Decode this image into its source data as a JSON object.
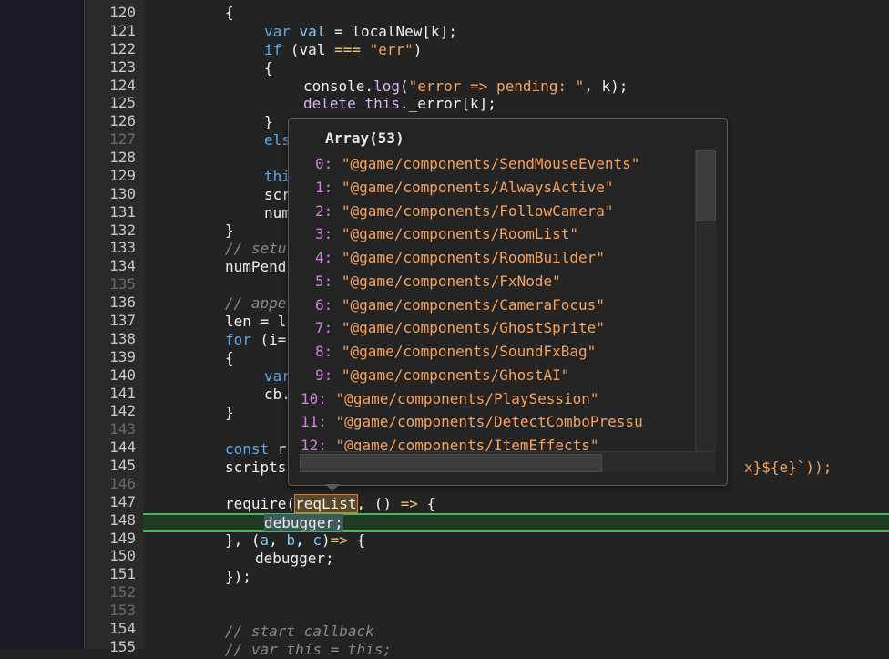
{
  "line_numbers": [
    {
      "n": "120",
      "dim": false
    },
    {
      "n": "121",
      "dim": false
    },
    {
      "n": "122",
      "dim": false
    },
    {
      "n": "123",
      "dim": false
    },
    {
      "n": "124",
      "dim": false
    },
    {
      "n": "125",
      "dim": false
    },
    {
      "n": "126",
      "dim": false
    },
    {
      "n": "127",
      "dim": true
    },
    {
      "n": "128",
      "dim": false
    },
    {
      "n": "129",
      "dim": false
    },
    {
      "n": "130",
      "dim": false
    },
    {
      "n": "131",
      "dim": false
    },
    {
      "n": "132",
      "dim": false
    },
    {
      "n": "133",
      "dim": false
    },
    {
      "n": "134",
      "dim": false
    },
    {
      "n": "135",
      "dim": true
    },
    {
      "n": "136",
      "dim": false
    },
    {
      "n": "137",
      "dim": false
    },
    {
      "n": "138",
      "dim": false
    },
    {
      "n": "139",
      "dim": false
    },
    {
      "n": "140",
      "dim": false
    },
    {
      "n": "141",
      "dim": false
    },
    {
      "n": "142",
      "dim": false
    },
    {
      "n": "143",
      "dim": true
    },
    {
      "n": "144",
      "dim": false
    },
    {
      "n": "145",
      "dim": false
    },
    {
      "n": "146",
      "dim": true
    },
    {
      "n": "147",
      "dim": false
    },
    {
      "n": "148",
      "dim": false
    },
    {
      "n": "149",
      "dim": false
    },
    {
      "n": "150",
      "dim": false
    },
    {
      "n": "151",
      "dim": false
    },
    {
      "n": "152",
      "dim": true
    },
    {
      "n": "153",
      "dim": true
    },
    {
      "n": "154",
      "dim": false
    },
    {
      "n": "155",
      "dim": false
    }
  ],
  "code": {
    "l120": "{",
    "l121_kw": "var",
    "l121_name": "val",
    "l121_op": " = ",
    "l121_rest": "localNew[k];",
    "l122_kw": "if",
    "l122_a": " (val ",
    "l122_op": "===",
    "l122_str": "\"err\"",
    "l122_b": ")",
    "l123": "{",
    "l124_a": "console.",
    "l124_fn": "log",
    "l124_b": "(",
    "l124_str": "\"error => pending: \"",
    "l124_c": ", k);",
    "l125_kw": "delete",
    "l125_this": "this",
    "l125_rest": "._error[k];",
    "l126": "}",
    "l127": "els",
    "l129": "thi",
    "l130": "scr",
    "l131": "num",
    "l132": "}",
    "l133": "// setu",
    "l134": "numPend",
    "l136": "// appe",
    "l137": "len = l",
    "l138_kw": "for",
    "l138_rest": " (i=",
    "l139": "{",
    "l140_kw": "var",
    "l141": "cb.",
    "l142": "}",
    "l144_kw": "const",
    "l144_rest": " r",
    "l145_a": "scripts",
    "l145_b": "x}${e}`));",
    "l147_a": "require(",
    "l147_hl": "reqList",
    "l147_b": ", () ",
    "l147_op": "=>",
    "l147_c": " {",
    "l148": "debugger;",
    "l149_a": "}, (",
    "l149_p1": "a",
    "l149_s1": ", ",
    "l149_p2": "b",
    "l149_s2": ", ",
    "l149_p3": "c",
    "l149_b": ")",
    "l149_op": "=>",
    "l149_c": " {",
    "l150": "debugger;",
    "l151": "});",
    "l154": "// start callback",
    "l155": "// var this = this;"
  },
  "popover": {
    "title": "Array(53)",
    "items": [
      {
        "idx": "0:",
        "val": "\"@game/components/SendMouseEvents\""
      },
      {
        "idx": "1:",
        "val": "\"@game/components/AlwaysActive\""
      },
      {
        "idx": "2:",
        "val": "\"@game/components/FollowCamera\""
      },
      {
        "idx": "3:",
        "val": "\"@game/components/RoomList\""
      },
      {
        "idx": "4:",
        "val": "\"@game/components/RoomBuilder\""
      },
      {
        "idx": "5:",
        "val": "\"@game/components/FxNode\""
      },
      {
        "idx": "6:",
        "val": "\"@game/components/CameraFocus\""
      },
      {
        "idx": "7:",
        "val": "\"@game/components/GhostSprite\""
      },
      {
        "idx": "8:",
        "val": "\"@game/components/SoundFxBag\""
      },
      {
        "idx": "9:",
        "val": "\"@game/components/GhostAI\""
      },
      {
        "idx": "10:",
        "val": "\"@game/components/PlaySession\""
      },
      {
        "idx": "11:",
        "val": "\"@game/components/DetectComboPressu"
      },
      {
        "idx": "12:",
        "val": "\"@game/components/ItemEffects\""
      }
    ]
  },
  "colors": {
    "editor_bg": "#232323",
    "keyword": "#5aa9e6",
    "string": "#f5a25d",
    "array_index": "#d47fe0",
    "paused_line_border": "#3dbb5a"
  }
}
